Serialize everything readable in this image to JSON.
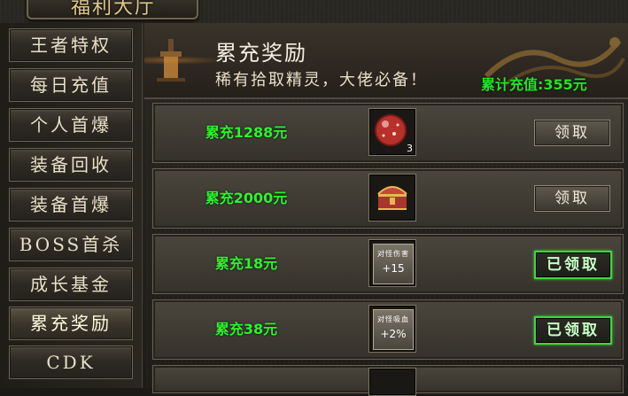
{
  "window": {
    "title": "福利大厅"
  },
  "sidebar": {
    "items": [
      {
        "label": "王者特权"
      },
      {
        "label": "每日充值"
      },
      {
        "label": "个人首爆"
      },
      {
        "label": "装备回收"
      },
      {
        "label": "装备首爆"
      },
      {
        "label": "BOSS首杀"
      },
      {
        "label": "成长基金"
      },
      {
        "label": "累充奖励"
      },
      {
        "label": "CDK"
      }
    ],
    "active_index": 7
  },
  "banner": {
    "title": "累充奖励",
    "subtitle": "稀有拾取精灵，大佬必备！",
    "total_recharge": "累计充值:355元"
  },
  "rewards": [
    {
      "requirement": "累充1288元",
      "item_icon": "red-orb-icon",
      "count": "3",
      "button": "领取",
      "claimed": false
    },
    {
      "requirement": "累充2000元",
      "item_icon": "treasure-chest-icon",
      "count": "",
      "button": "领取",
      "claimed": false
    },
    {
      "requirement": "累充18元",
      "item_icon": "damage-buff-icon",
      "buff_title": "对怪伤害",
      "buff_value": "+15",
      "button": "已领取",
      "claimed": true
    },
    {
      "requirement": "累充38元",
      "item_icon": "lifesteal-buff-icon",
      "buff_title": "对怪吸血",
      "buff_value": "+2%",
      "button": "已领取",
      "claimed": true
    }
  ],
  "colors": {
    "accent_green": "#2df42d",
    "gold_text": "#e2c98d",
    "claimed_border": "#3fd53f"
  }
}
